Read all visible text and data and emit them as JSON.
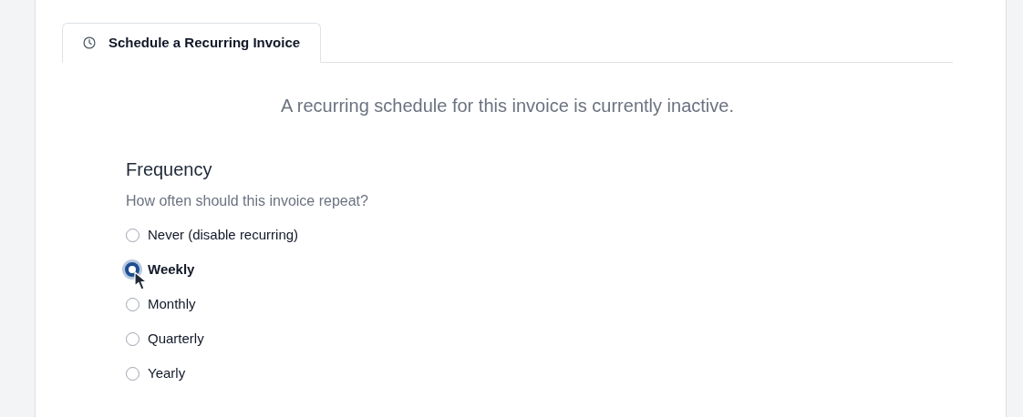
{
  "tabs": [
    {
      "label": "Schedule a Recurring Invoice",
      "selected": true
    }
  ],
  "status_message": "A recurring schedule for this invoice is currently inactive.",
  "frequency": {
    "heading": "Frequency",
    "hint": "How often should this invoice repeat?",
    "options": [
      {
        "label": "Never (disable recurring)",
        "selected": false
      },
      {
        "label": "Weekly",
        "selected": true
      },
      {
        "label": "Monthly",
        "selected": false
      },
      {
        "label": "Quarterly",
        "selected": false
      },
      {
        "label": "Yearly",
        "selected": false
      }
    ]
  }
}
